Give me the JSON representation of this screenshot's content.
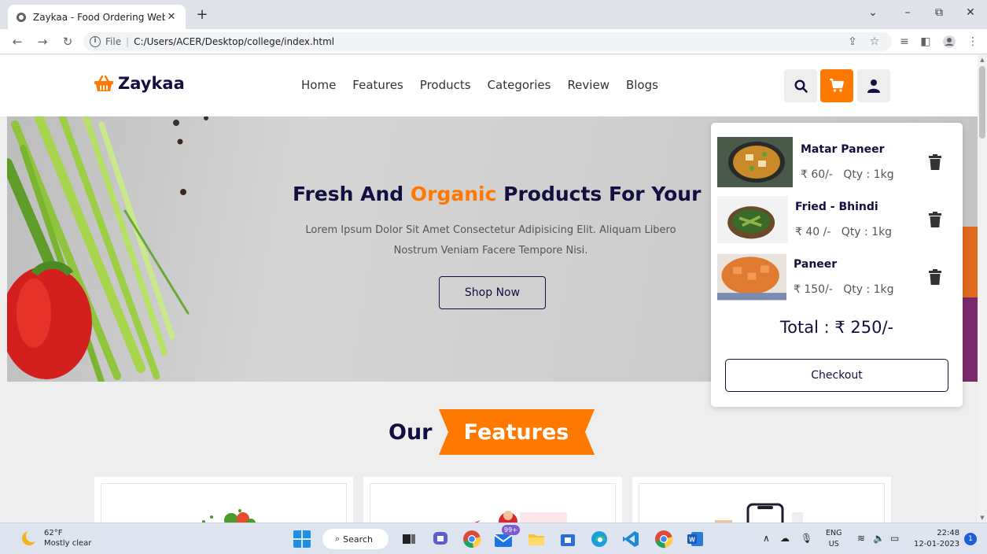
{
  "browser": {
    "tab_title": "Zaykaa - Food Ordering Website",
    "tab_close": "✕",
    "new_tab": "+",
    "file_label": "File",
    "url": "C:/Users/ACER/Desktop/college/index.html"
  },
  "header": {
    "logo_text": "Zaykaa",
    "nav": [
      "Home",
      "Features",
      "Products",
      "Categories",
      "Review",
      "Blogs"
    ],
    "accent_color": "#ff7800"
  },
  "hero": {
    "title_before": "Fresh And ",
    "title_highlight": "Organic",
    "title_after": " Products For Your",
    "description": "Lorem Ipsum Dolor Sit Amet Consectetur Adipisicing Elit. Aliquam Libero Nostrum Veniam Facere Tempore Nisi.",
    "button": "Shop Now"
  },
  "cart": {
    "items": [
      {
        "name": "Matar Paneer",
        "price": "₹ 60/-",
        "qty": "Qty : 1kg"
      },
      {
        "name": "Fried - Bhindi",
        "price": "₹ 40 /-",
        "qty": "Qty : 1kg"
      },
      {
        "name": "Paneer",
        "price": "₹ 150/-",
        "qty": "Qty : 1kg"
      }
    ],
    "total": "Total : ₹ 250/-",
    "checkout": "Checkout"
  },
  "features": {
    "title_dark": "Our",
    "title_highlight": "Features"
  },
  "taskbar": {
    "temperature": "62°F",
    "weather": "Mostly clear",
    "search": "Search",
    "badge": "99+",
    "lang_top": "ENG",
    "lang_bottom": "US",
    "time": "22:48",
    "date": "12-01-2023",
    "notifications": "1"
  }
}
